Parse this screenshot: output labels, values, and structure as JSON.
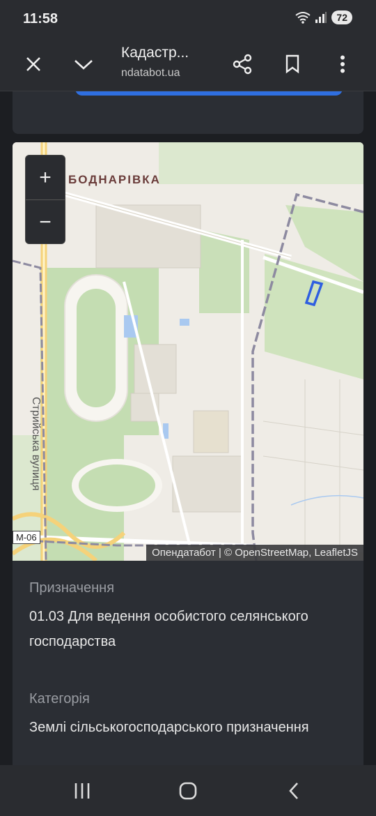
{
  "status_bar": {
    "time": "11:58",
    "battery": "72",
    "icons": [
      "wifi-icon",
      "signal-icon",
      "battery-icon"
    ]
  },
  "toolbar": {
    "title": "Кадастр...",
    "url": "ndatabot.ua",
    "icons": [
      "close-icon",
      "chevron-down-icon",
      "share-icon",
      "bookmark-icon",
      "more-icon"
    ]
  },
  "map": {
    "zoom_in": "+",
    "zoom_out": "−",
    "place_label": "БОДНАРІВКА",
    "street_label": "Стрийська вулиця",
    "road_shield": "М-06",
    "attribution": "Опендатабот | © OpenStreetMap, LeafletJS"
  },
  "details": {
    "purpose_label": "Призначення",
    "purpose_value": "01.03 Для ведення особистого селянського господарства",
    "category_label": "Категорія",
    "category_value": "Землі сільськогосподарського призначення"
  },
  "nav_bar": {
    "icons": [
      "recent-apps-icon",
      "home-icon",
      "back-icon"
    ]
  },
  "colors": {
    "accent": "#2f6fe0",
    "background": "#1c1e22",
    "card": "#2b2e34"
  }
}
